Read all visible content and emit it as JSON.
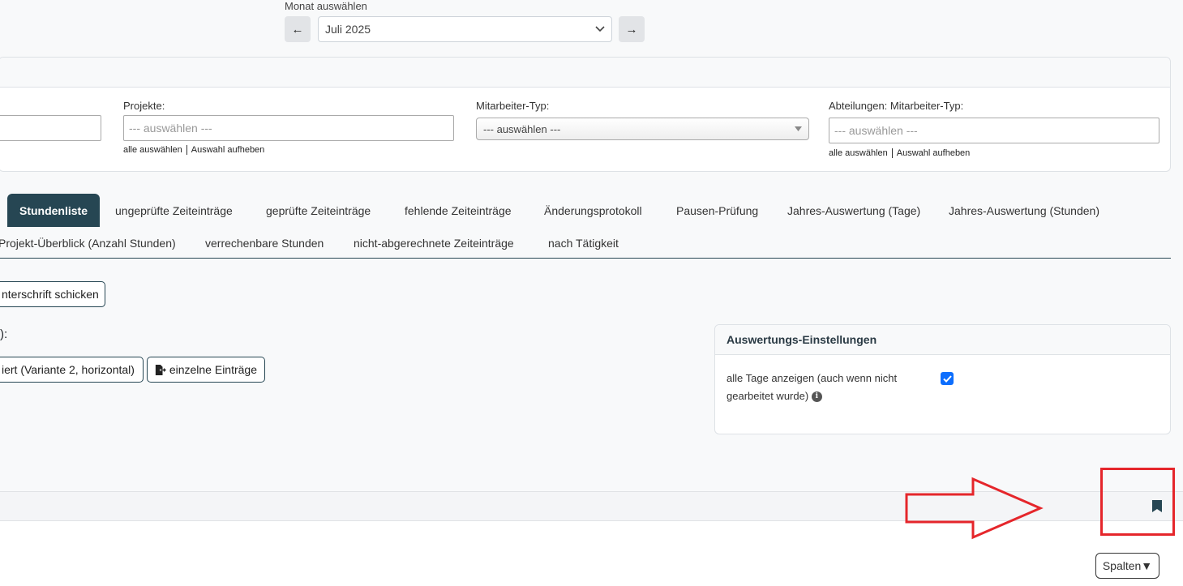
{
  "month": {
    "label": "Monat auswählen",
    "prev": "←",
    "next": "→",
    "selected": "Juli 2025"
  },
  "filters": {
    "projekte_label": "Projekte:",
    "projekte_placeholder": "--- auswählen ---",
    "mitarbeiter_typ_label": "Mitarbeiter-Typ:",
    "mitarbeiter_typ_selected": "--- auswählen ---",
    "abteilungen_label": "Abteilungen: Mitarbeiter-Typ:",
    "abteilungen_placeholder": "--- auswählen ---",
    "select_all": "alle auswählen",
    "clear_selection": "Auswahl aufheben"
  },
  "tabs": {
    "row1": [
      "Stundenliste",
      "ungeprüfte Zeiteinträge",
      "geprüfte Zeiteinträge",
      "fehlende Zeiteinträge",
      "Änderungsprotokoll",
      "Pausen-Prüfung",
      "Jahres-Auswertung (Tage)",
      "Jahres-Auswertung (Stunden)"
    ],
    "row2": [
      "Projekt-Überblick (Anzahl Stunden)",
      "verrechenbare Stunden",
      "nicht-abgerechnete Zeiteinträge",
      "nach Tätigkeit"
    ]
  },
  "actions": {
    "signature_button": "nterschrift schicken",
    "export_label": "):",
    "export_variant2": "iert (Variante 2, horizontal)",
    "export_single": "einzelne Einträge"
  },
  "settings": {
    "title": "Auswertungs-Einstellungen",
    "show_all_days": "alle Tage anzeigen (auch wenn nicht gearbeitet wurde)",
    "show_all_days_checked": true,
    "info_icon": "info-circle-icon"
  },
  "table": {
    "columns_button": "Spalten▼",
    "bookmark_icon": "bookmark-icon"
  },
  "annotation": {
    "color": "#e5262b"
  }
}
